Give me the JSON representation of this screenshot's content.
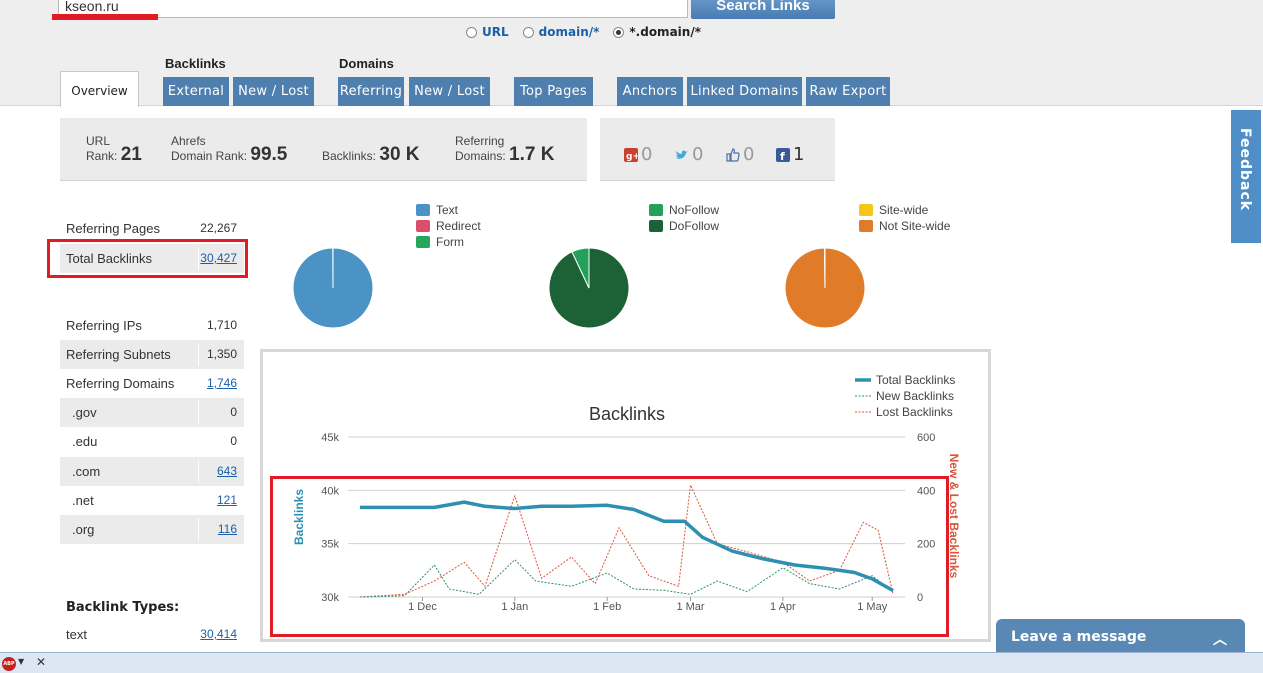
{
  "search": {
    "value": "kseon.ru",
    "button": "Search Links"
  },
  "scope": [
    {
      "label": "URL",
      "selected": false
    },
    {
      "label": "domain/*",
      "selected": false
    },
    {
      "label": "*.domain/*",
      "selected": true
    }
  ],
  "nav": {
    "overview": "Overview",
    "backlinks_title": "Backlinks",
    "domains_title": "Domains",
    "external": "External",
    "new_lost_1": "New / Lost",
    "referring": "Referring",
    "new_lost_2": "New / Lost",
    "top_pages": "Top Pages",
    "anchors": "Anchors",
    "linked_domains": "Linked Domains",
    "raw_export": "Raw Export"
  },
  "stats": {
    "url_rank_l1": "URL",
    "url_rank_l2": "Rank:",
    "url_rank": "21",
    "domain_rank_l1": "Ahrefs",
    "domain_rank_l2": "Domain Rank:",
    "domain_rank": "99.5",
    "backlinks_l": "Backlinks:",
    "backlinks": "30 K",
    "refdomains_l1": "Referring",
    "refdomains_l2": "Domains:",
    "refdomains": "1.7 K"
  },
  "social": {
    "gplus": "0",
    "twitter": "0",
    "like": "0",
    "facebook": "1"
  },
  "left_table": {
    "rows1": [
      {
        "k": "Referring Pages",
        "v": "22,267"
      },
      {
        "k": "Total Backlinks",
        "v": "30,427"
      }
    ],
    "rows2": [
      {
        "k": "Referring IPs",
        "v": "1,710"
      },
      {
        "k": "Referring Subnets",
        "v": "1,350"
      },
      {
        "k": "Referring Domains",
        "v": "1,746"
      },
      {
        "k": ".gov",
        "v": "0"
      },
      {
        "k": ".edu",
        "v": "0"
      },
      {
        "k": ".com",
        "v": "643"
      },
      {
        "k": ".net",
        "v": "121"
      },
      {
        "k": ".org",
        "v": "116"
      }
    ],
    "types_title": "Backlink Types:",
    "text_row": {
      "k": "text",
      "v": "30,414"
    }
  },
  "legends": {
    "text": "Text",
    "redirect": "Redirect",
    "form": "Form",
    "nofollow": "NoFollow",
    "dofollow": "DoFollow",
    "sitewide": "Site-wide",
    "notsitewide": "Not Site-wide"
  },
  "colors": {
    "text": "#4b93c5",
    "redirect": "#d94f6b",
    "form": "#26a65b",
    "nofollow": "#23a05a",
    "dofollow": "#1d6236",
    "sitewide": "#f5c518",
    "notsitewide": "#e07b2a",
    "total_line": "#2e8fb0",
    "new_line": "#2e8f73",
    "lost_line": "#d8563a"
  },
  "pies": [
    {
      "name": "types",
      "slices": [
        {
          "label": "Text",
          "value": 99.95
        },
        {
          "label": "Redirect",
          "value": 0.05
        }
      ]
    },
    {
      "name": "follow",
      "slices": [
        {
          "label": "DoFollow",
          "value": 93
        },
        {
          "label": "NoFollow",
          "value": 7
        }
      ]
    },
    {
      "name": "sitewide",
      "slices": [
        {
          "label": "Not Site-wide",
          "value": 99.8
        },
        {
          "label": "Site-wide",
          "value": 0.2
        }
      ]
    }
  ],
  "chart_data": {
    "type": "line",
    "title": "Backlinks",
    "ylabel": "Backlinks",
    "y2label": "New & Lost Backlinks",
    "ylim": [
      30000,
      45000
    ],
    "y2lim": [
      0,
      600
    ],
    "yticks": [
      "45k",
      "40k",
      "35k",
      "30k"
    ],
    "y2ticks": [
      "600",
      "400",
      "200",
      "0"
    ],
    "xlabels": [
      "1 Dec",
      "1 Jan",
      "1 Feb",
      "1 Mar",
      "1 Apr",
      "1 May"
    ],
    "legend": [
      "Total Backlinks",
      "New Backlinks",
      "Lost Backlinks"
    ],
    "series": [
      {
        "name": "Total Backlinks",
        "axis": "left",
        "x": [
          "2012-11-10",
          "2012-11-25",
          "2012-12-05",
          "2012-12-15",
          "2012-12-22",
          "2013-01-01",
          "2013-01-10",
          "2013-01-20",
          "2013-02-01",
          "2013-02-10",
          "2013-02-20",
          "2013-02-27",
          "2013-03-05",
          "2013-03-15",
          "2013-03-25",
          "2013-04-05",
          "2013-04-15",
          "2013-04-25",
          "2013-05-01",
          "2013-05-08"
        ],
        "values": [
          38400,
          38400,
          38400,
          38900,
          38500,
          38300,
          38500,
          38500,
          38600,
          38200,
          37100,
          37100,
          35600,
          34300,
          33600,
          33000,
          32700,
          32300,
          31700,
          30600
        ]
      },
      {
        "name": "New Backlinks",
        "axis": "right",
        "x": [
          "2012-11-10",
          "2012-11-25",
          "2012-12-05",
          "2012-12-10",
          "2012-12-20",
          "2013-01-01",
          "2013-01-08",
          "2013-01-20",
          "2013-02-01",
          "2013-02-10",
          "2013-02-20",
          "2013-03-01",
          "2013-03-10",
          "2013-03-20",
          "2013-04-01",
          "2013-04-10",
          "2013-04-20",
          "2013-05-01",
          "2013-05-08"
        ],
        "values": [
          0,
          5,
          120,
          30,
          10,
          140,
          60,
          40,
          90,
          30,
          25,
          10,
          60,
          20,
          110,
          50,
          30,
          80,
          20
        ]
      },
      {
        "name": "Lost Backlinks",
        "axis": "right",
        "x": [
          "2012-11-10",
          "2012-11-25",
          "2012-12-05",
          "2012-12-15",
          "2012-12-22",
          "2013-01-01",
          "2013-01-10",
          "2013-01-20",
          "2013-01-28",
          "2013-02-05",
          "2013-02-15",
          "2013-02-25",
          "2013-03-01",
          "2013-03-10",
          "2013-03-20",
          "2013-04-01",
          "2013-04-10",
          "2013-04-20",
          "2013-04-28",
          "2013-05-03",
          "2013-05-08"
        ],
        "values": [
          0,
          10,
          60,
          130,
          40,
          380,
          70,
          150,
          50,
          260,
          80,
          40,
          420,
          200,
          170,
          130,
          60,
          100,
          280,
          250,
          10
        ]
      }
    ]
  },
  "feedback": "Feedback",
  "leave_message": "Leave a message",
  "leave_chevron": "︿",
  "abp": "ABP",
  "arrow": "▼",
  "close": "✕"
}
